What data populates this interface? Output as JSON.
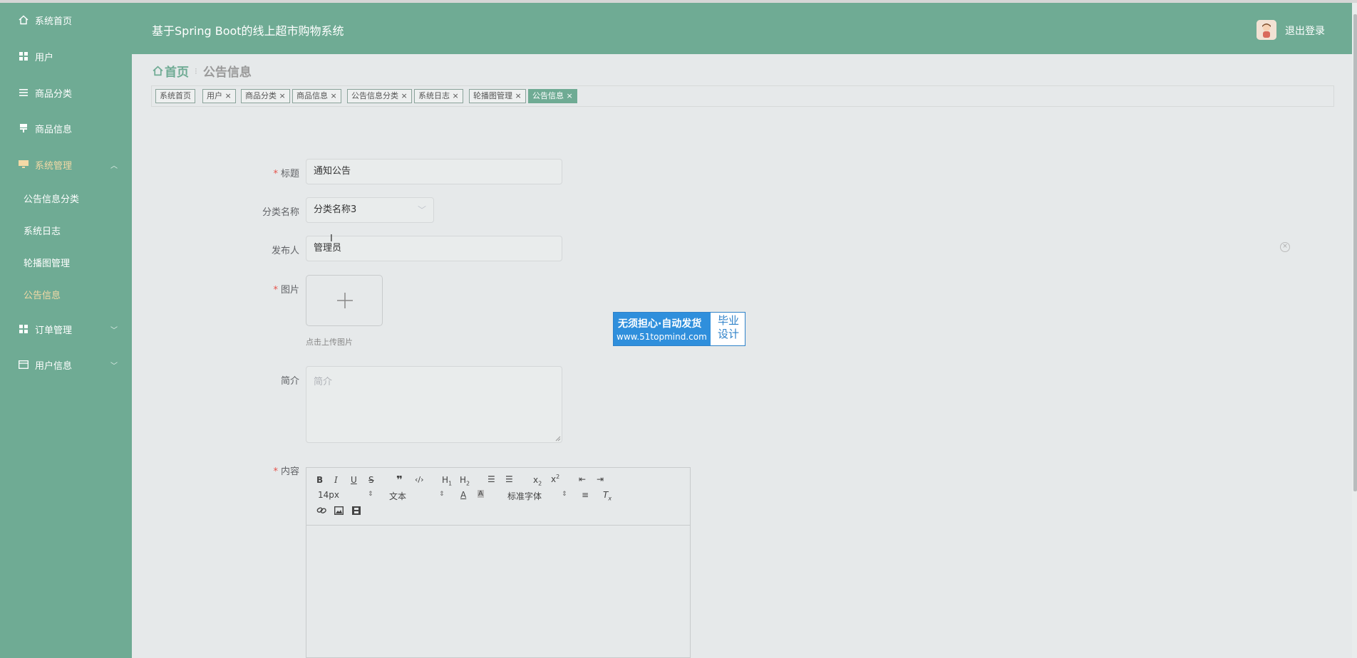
{
  "header": {
    "title": "基于Spring Boot的线上超市购物系统",
    "logout_label": "退出登录"
  },
  "sidebar": {
    "items": [
      {
        "label": "系统首页",
        "icon": "home-icon"
      },
      {
        "label": "用户",
        "icon": "grid-icon"
      },
      {
        "label": "商品分类",
        "icon": "list-icon"
      },
      {
        "label": "商品信息",
        "icon": "tag-icon"
      },
      {
        "label": "系统管理",
        "icon": "monitor-icon"
      },
      {
        "label": "订单管理",
        "icon": "grid-icon"
      },
      {
        "label": "用户信息",
        "icon": "card-icon"
      }
    ],
    "sub_items": [
      {
        "label": "公告信息分类"
      },
      {
        "label": "系统日志"
      },
      {
        "label": "轮播图管理"
      },
      {
        "label": "公告信息"
      }
    ],
    "accent_color": "#6fab94",
    "active_color": "#f3d9a6"
  },
  "breadcrumb": {
    "home": "首页",
    "current": "公告信息"
  },
  "tags": [
    {
      "label": "系统首页"
    },
    {
      "label": "用户"
    },
    {
      "label": "商品分类"
    },
    {
      "label": "商品信息"
    },
    {
      "label": "公告信息分类"
    },
    {
      "label": "系统日志"
    },
    {
      "label": "轮播图管理"
    },
    {
      "label": "公告信息"
    }
  ],
  "form": {
    "title_label": "标题",
    "title_value": "通知公告",
    "category_label": "分类名称",
    "category_value": "分类名称3",
    "publisher_label": "发布人",
    "publisher_value": "管理员",
    "image_label": "图片",
    "upload_tip": "点击上传图片",
    "intro_label": "简介",
    "intro_placeholder": "简介",
    "content_label": "内容",
    "required_mark": "*"
  },
  "editor": {
    "font_size": "14px",
    "header_select": "文本",
    "font_family": "标准字体"
  },
  "watermark": {
    "line1": "无须担心·自动发货",
    "line2": "www.51topmind.com",
    "right1": "毕业",
    "right2": "设计"
  }
}
